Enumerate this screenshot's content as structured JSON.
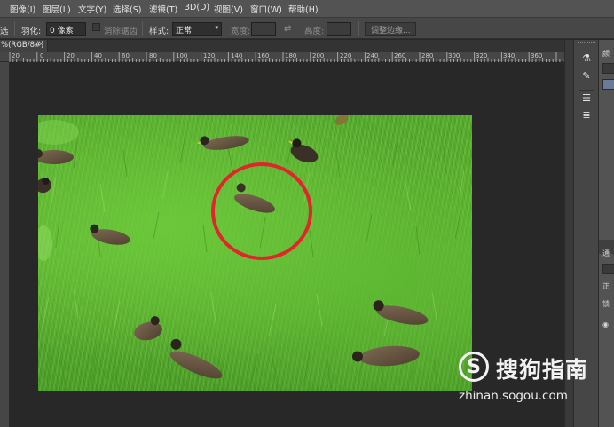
{
  "menu": [
    "图像(I)",
    "图层(L)",
    "文字(Y)",
    "选择(S)",
    "滤镜(T)",
    "3D(D)",
    "视图(V)",
    "窗口(W)",
    "帮助(H)"
  ],
  "options_bar": {
    "tool_fragment": "选",
    "feather_label": "羽化:",
    "feather_value": "0 像素",
    "antialias_label": "消除锯齿",
    "style_label": "样式:",
    "style_value": "正常",
    "width_label": "宽度:",
    "height_label": "高度:",
    "refine_edge_button": "调整边缘..."
  },
  "document_tab": {
    "label": "%(RGB/8#)",
    "close_glyph": "×"
  },
  "ruler": {
    "labels": [
      "20",
      "0",
      "20",
      "40",
      "60",
      "80",
      "100",
      "120",
      "140",
      "160",
      "180",
      "200",
      "220",
      "240",
      "260",
      "280",
      "300",
      "320",
      "340",
      "360"
    ]
  },
  "canvas": {
    "highlight_color": "#e0262b",
    "grass_color": "#5cb631"
  },
  "tools": [
    "brush-settings-icon",
    "brush-icon",
    "adjust-icon",
    "properties-icon"
  ],
  "right_panel": {
    "fragment_1": "颜",
    "fragment_2": "通",
    "fragment_3": "正",
    "fragment_4": "锁"
  },
  "watermark": {
    "logo_letter": "S",
    "title": "搜狗指南",
    "url": "zhinan.sogou.com"
  }
}
